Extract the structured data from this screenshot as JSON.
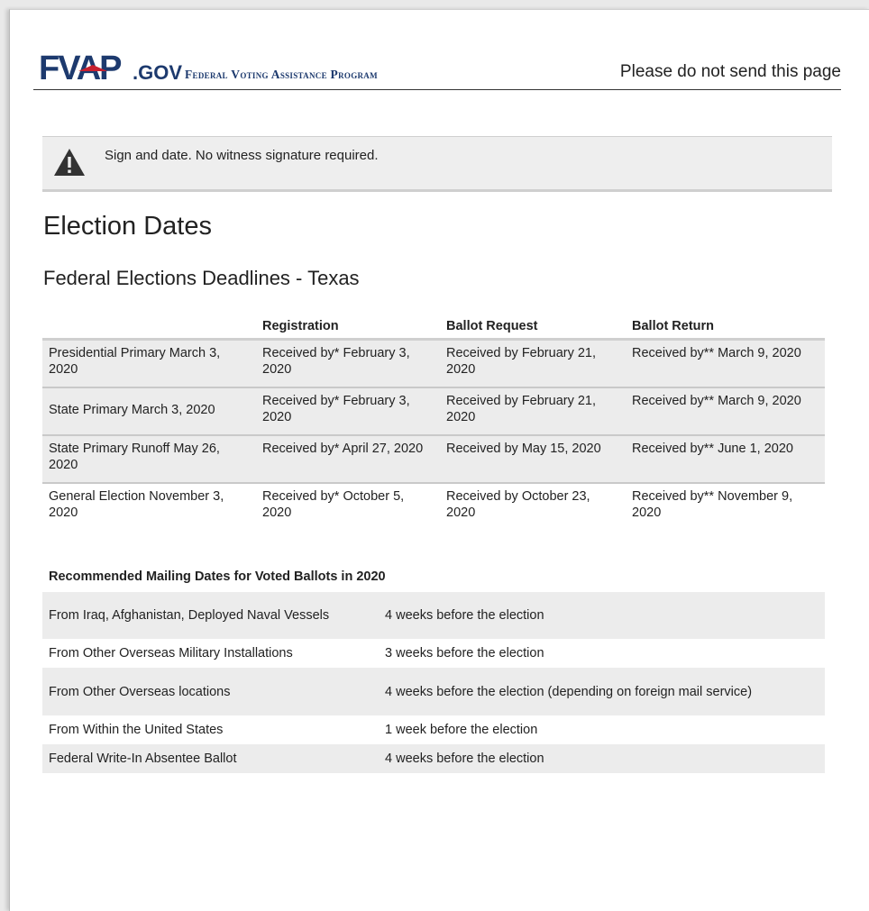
{
  "header": {
    "logo_main": "FVAP",
    "logo_suffix": ".GOV",
    "logo_subtitle": "Federal Voting Assistance Program",
    "notice": "Please do not send this page"
  },
  "alert": {
    "icon": "warning-icon",
    "text": "Sign and date. No witness signature required."
  },
  "page_title": "Election Dates",
  "section_title": "Federal Elections Deadlines - Texas",
  "deadlines": {
    "headers": [
      "",
      "Registration",
      "Ballot Request",
      "Ballot Return"
    ],
    "rows": [
      [
        "Presidential Primary March 3, 2020",
        "Received by* February 3, 2020",
        "Received by February 21, 2020",
        "Received by** March 9, 2020"
      ],
      [
        "State Primary March 3, 2020",
        "Received by* February 3, 2020",
        "Received by February 21, 2020",
        "Received by** March 9, 2020"
      ],
      [
        "State Primary Runoff May 26, 2020",
        "Received by* April 27, 2020",
        "Received by May 15, 2020",
        "Received by** June 1, 2020"
      ],
      [
        "General Election November 3, 2020",
        "Received by* October 5, 2020",
        "Received by October 23, 2020",
        "Received by** November 9, 2020"
      ]
    ]
  },
  "mailing": {
    "title": "Recommended Mailing Dates for Voted Ballots in 2020",
    "rows": [
      [
        "From Iraq, Afghanistan, Deployed Naval Vessels",
        "4 weeks before the election"
      ],
      [
        "From Other Overseas Military Installations",
        "3 weeks before the election"
      ],
      [
        "From Other Overseas locations",
        "4 weeks before the election (depending on foreign mail service)"
      ],
      [
        "From Within the United States",
        "1 week before the election"
      ],
      [
        "Federal Write-In Absentee Ballot",
        "4 weeks before the election"
      ]
    ]
  },
  "colors": {
    "logo_blue": "#1d3a6e",
    "logo_red": "#c8202f",
    "shade": "#ececec"
  }
}
